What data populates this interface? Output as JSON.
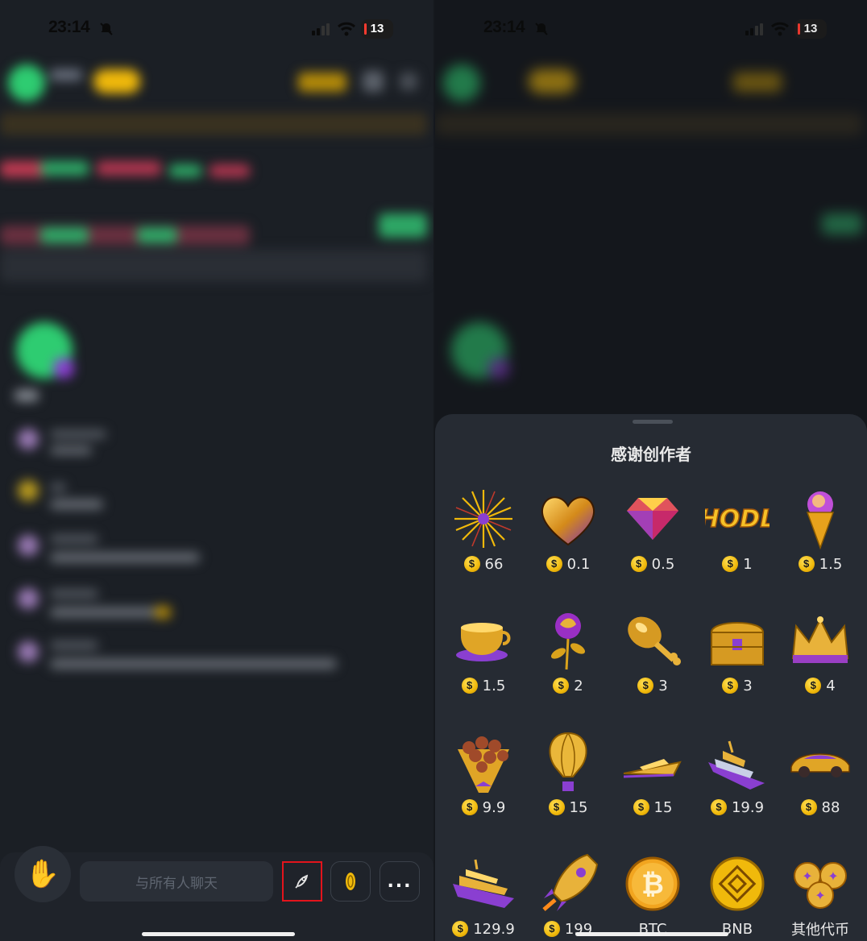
{
  "status_bar": {
    "time": "23:14",
    "battery": "13"
  },
  "left_screen": {
    "chat_placeholder": "与所有人聊天",
    "more_label": "..."
  },
  "gift_sheet": {
    "title": "感谢创作者",
    "currency_symbol": "$",
    "gifts": [
      {
        "icon": "fireworks-icon",
        "price": "66"
      },
      {
        "icon": "gold-heart-icon",
        "price": "0.1"
      },
      {
        "icon": "diamond-icon",
        "price": "0.5"
      },
      {
        "icon": "hodl-icon",
        "price": "1",
        "art_text": "HODL"
      },
      {
        "icon": "ice-cream-icon",
        "price": "1.5"
      },
      {
        "icon": "coffee-cup-icon",
        "price": "1.5"
      },
      {
        "icon": "rose-icon",
        "price": "2"
      },
      {
        "icon": "drumstick-icon",
        "price": "3"
      },
      {
        "icon": "treasure-chest-icon",
        "price": "3"
      },
      {
        "icon": "crown-icon",
        "price": "4"
      },
      {
        "icon": "bouquet-icon",
        "price": "9.9"
      },
      {
        "icon": "hot-air-balloon-icon",
        "price": "15"
      },
      {
        "icon": "yacht-small-icon",
        "price": "15"
      },
      {
        "icon": "yacht-icon",
        "price": "19.9"
      },
      {
        "icon": "sports-car-icon",
        "price": "88"
      },
      {
        "icon": "cruise-ship-icon",
        "price": "129.9"
      },
      {
        "icon": "rocket-icon",
        "price": "199"
      },
      {
        "icon": "btc-coin-icon",
        "label": "BTC"
      },
      {
        "icon": "bnb-coin-icon",
        "label": "BNB"
      },
      {
        "icon": "other-coins-icon",
        "label": "其他代币"
      }
    ]
  },
  "colors": {
    "gold": "#f0b90b",
    "purple": "#8a3fd1",
    "highlight_box": "#e3141c",
    "sheet_bg": "#262b33"
  }
}
